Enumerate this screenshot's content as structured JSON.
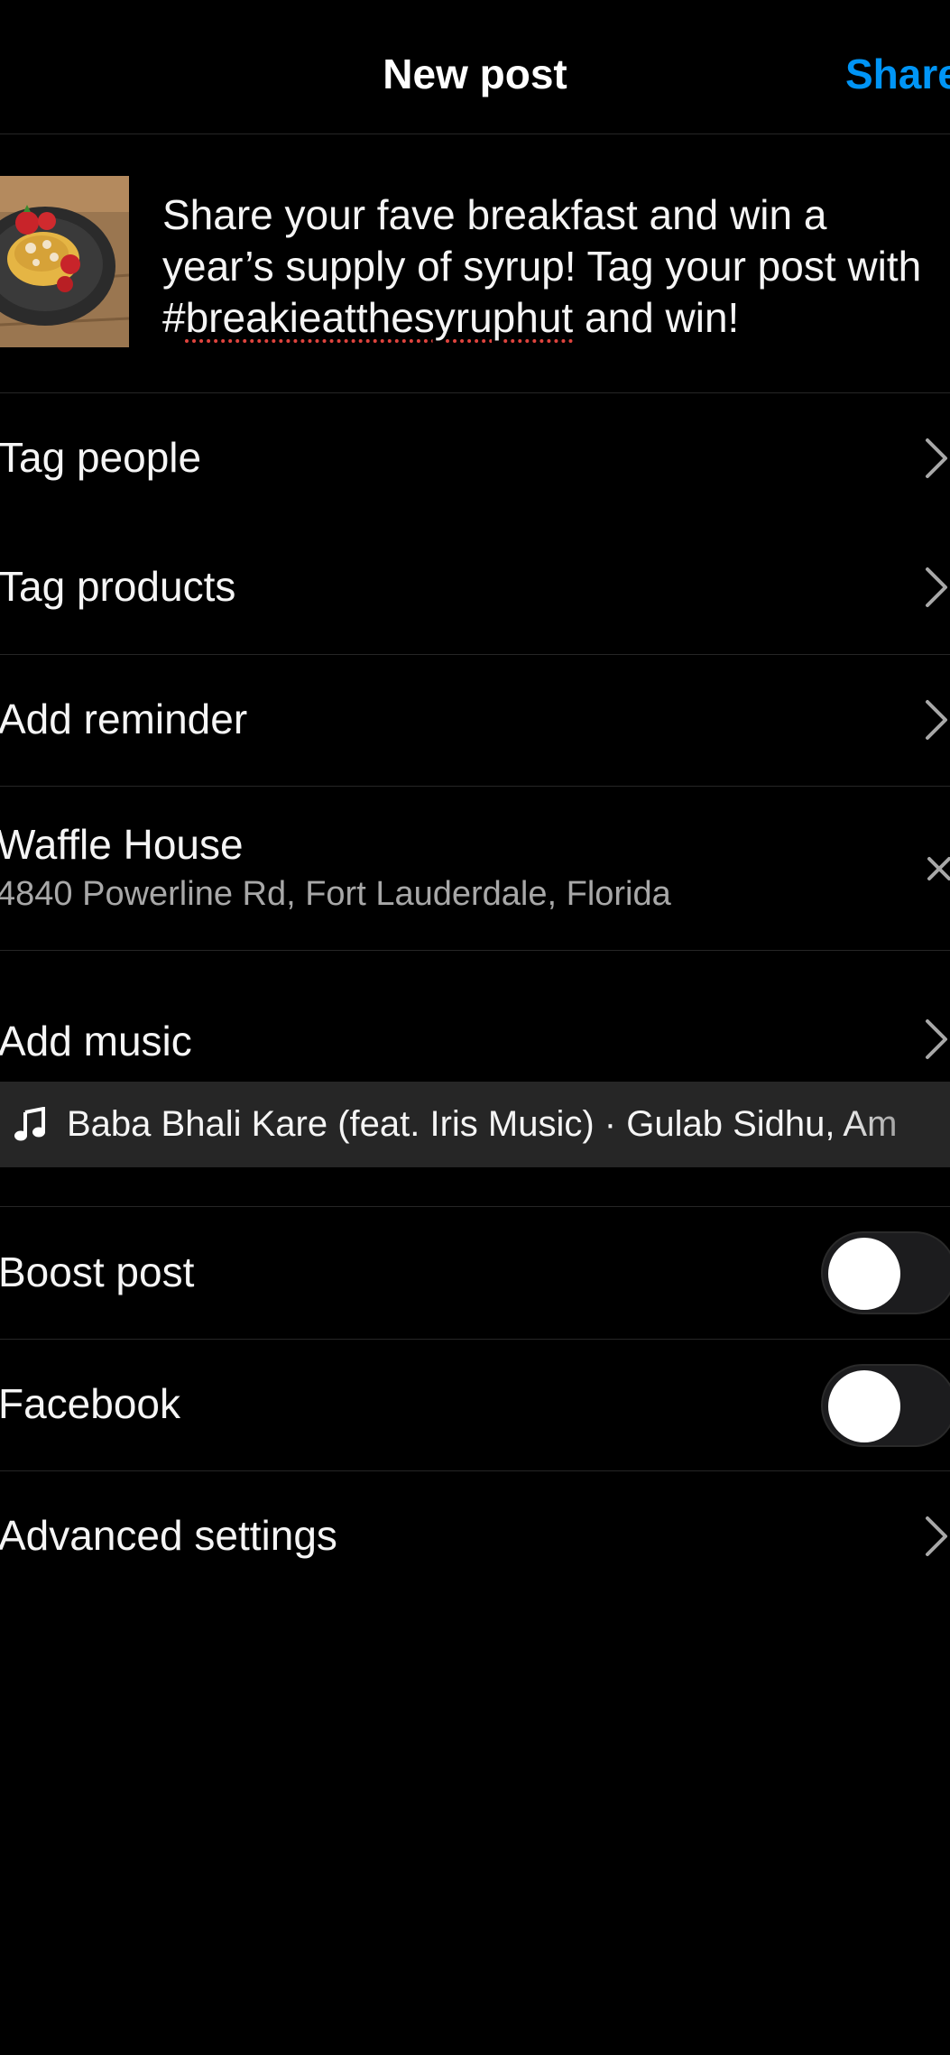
{
  "header": {
    "title": "New post",
    "share_label": "Share"
  },
  "post": {
    "thumbnail_name": "breakfast-plate-photo",
    "caption_before": "Share your fave breakfast and win a year’s supply of syrup! Tag your post with #",
    "caption_hashtag": "breakieatthesyruphut",
    "caption_after": " and win!"
  },
  "options": {
    "tag_people": "Tag people",
    "tag_products": "Tag products",
    "add_reminder": "Add reminder",
    "add_music": "Add music",
    "boost_post": "Boost post",
    "facebook": "Facebook",
    "advanced_settings": "Advanced settings"
  },
  "location": {
    "name": "Waffle House",
    "address": "4840 Powerline Rd, Fort Lauderdale, Florida"
  },
  "music": {
    "track": "Baba Bhali Kare (feat. Iris Music) · Gulab Sidhu, Am"
  },
  "toggles": {
    "boost_post_on": false,
    "facebook_on": false
  },
  "colors": {
    "accent": "#0095f6",
    "background": "#000000",
    "secondary_text": "#a8a8a8",
    "divider": "#262626"
  },
  "icons": [
    "back-arrow-icon",
    "chevron-right-icon",
    "close-icon",
    "music-note-icon"
  ]
}
